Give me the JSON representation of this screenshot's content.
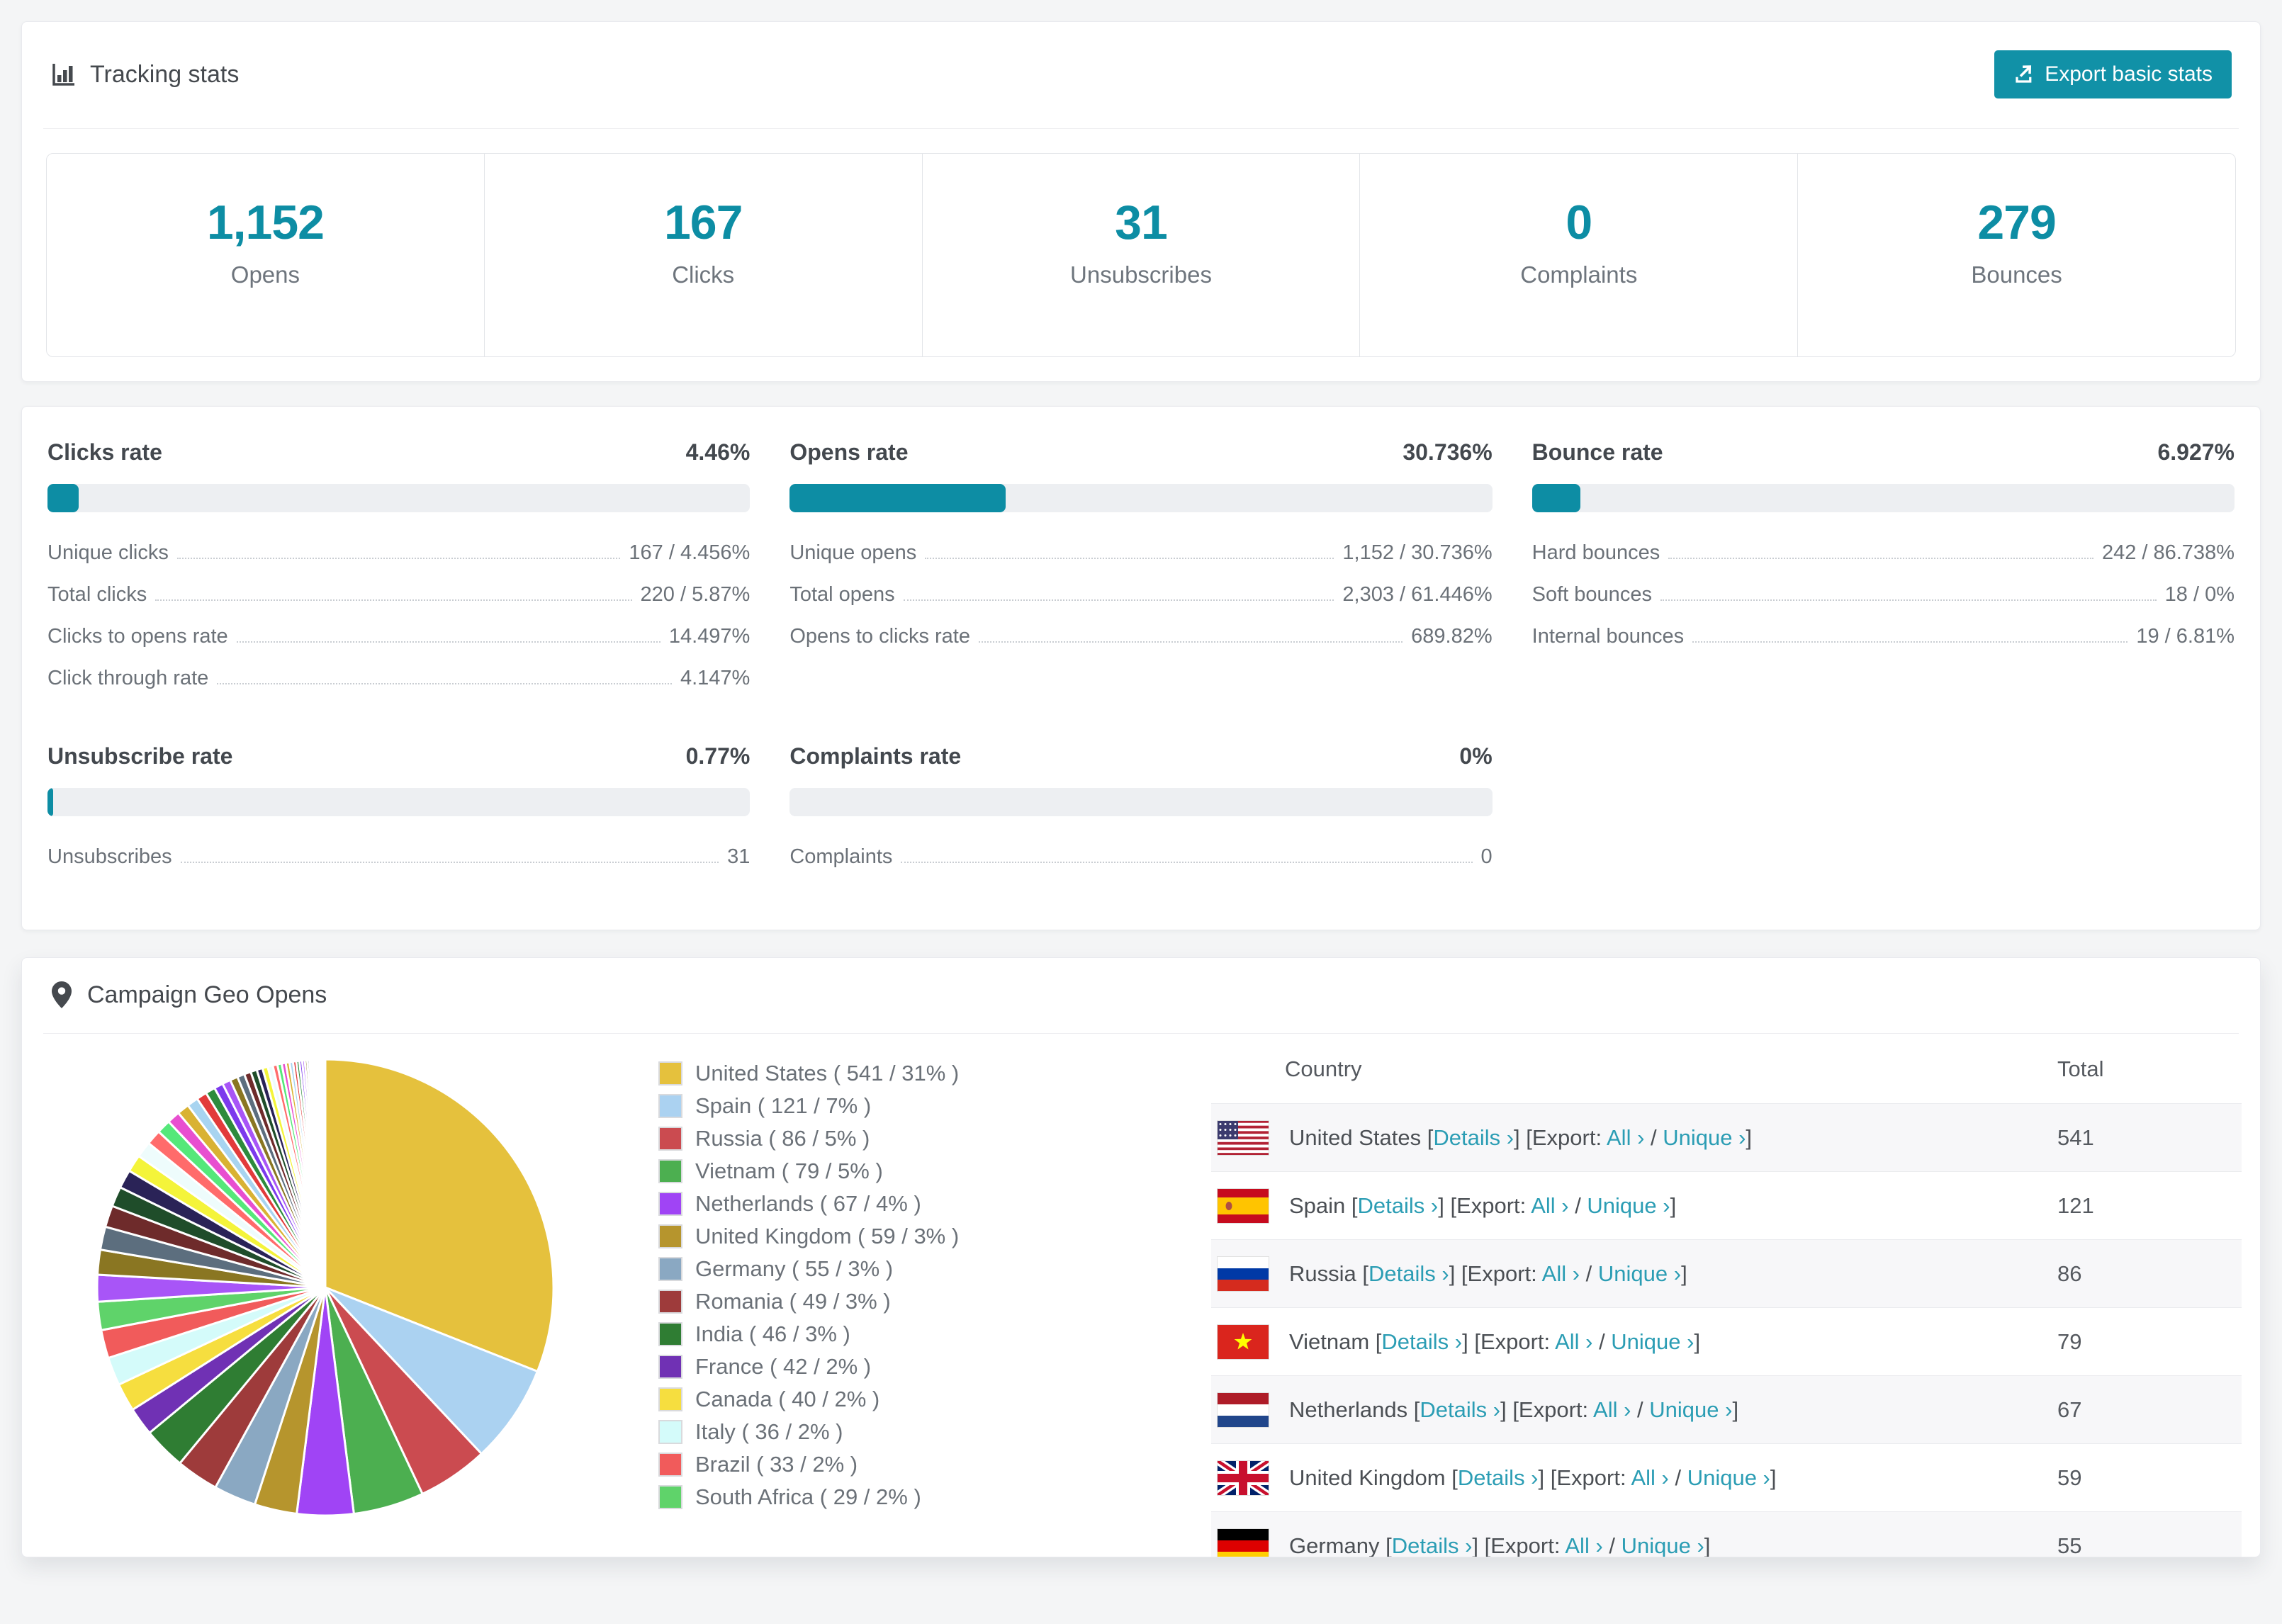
{
  "accent": "#0d8da4",
  "link_color": "#2b9db4",
  "tracking": {
    "title": "Tracking stats",
    "export_button": "Export basic stats",
    "stats": [
      {
        "value": "1,152",
        "label": "Opens"
      },
      {
        "value": "167",
        "label": "Clicks"
      },
      {
        "value": "31",
        "label": "Unsubscribes"
      },
      {
        "value": "0",
        "label": "Complaints"
      },
      {
        "value": "279",
        "label": "Bounces"
      }
    ]
  },
  "rates": [
    {
      "title": "Clicks rate",
      "value": "4.46%",
      "pct": 4.46,
      "rows": [
        {
          "label": "Unique clicks",
          "value": "167 / 4.456%"
        },
        {
          "label": "Total clicks",
          "value": "220 / 5.87%"
        },
        {
          "label": "Clicks to opens rate",
          "value": "14.497%"
        },
        {
          "label": "Click through rate",
          "value": "4.147%"
        }
      ]
    },
    {
      "title": "Opens rate",
      "value": "30.736%",
      "pct": 30.736,
      "rows": [
        {
          "label": "Unique opens",
          "value": "1,152 / 30.736%"
        },
        {
          "label": "Total opens",
          "value": "2,303 / 61.446%"
        },
        {
          "label": "Opens to clicks rate",
          "value": "689.82%"
        }
      ]
    },
    {
      "title": "Bounce rate",
      "value": "6.927%",
      "pct": 6.927,
      "rows": [
        {
          "label": "Hard bounces",
          "value": "242 / 86.738%"
        },
        {
          "label": "Soft bounces",
          "value": "18 / 0%"
        },
        {
          "label": "Internal bounces",
          "value": "19 / 6.81%"
        }
      ]
    },
    {
      "title": "Unsubscribe rate",
      "value": "0.77%",
      "pct": 0.77,
      "rows": [
        {
          "label": "Unsubscribes",
          "value": "31"
        }
      ]
    },
    {
      "title": "Complaints rate",
      "value": "0%",
      "pct": 0,
      "rows": [
        {
          "label": "Complaints",
          "value": "0"
        }
      ]
    }
  ],
  "geo": {
    "title": "Campaign Geo Opens",
    "legend_format": "{label} ( {value} / {pct}% )",
    "table": {
      "col_country": "Country",
      "col_total": "Total",
      "details_label": "Details ›",
      "export_prefix": "Export:",
      "all_label": "All ›",
      "unique_label": "Unique ›",
      "lb": "[",
      "rb": "]",
      "sep": " / ",
      "rows": [
        {
          "country": "United States",
          "flag": "us",
          "total": "541"
        },
        {
          "country": "Spain",
          "flag": "es",
          "total": "121"
        },
        {
          "country": "Russia",
          "flag": "ru",
          "total": "86"
        },
        {
          "country": "Vietnam",
          "flag": "vn",
          "total": "79"
        },
        {
          "country": "Netherlands",
          "flag": "nl",
          "total": "67"
        },
        {
          "country": "United Kingdom",
          "flag": "gb",
          "total": "59"
        },
        {
          "country": "Germany",
          "flag": "de",
          "total": "55"
        }
      ]
    },
    "chart_data": {
      "type": "pie",
      "title": "Campaign Geo Opens",
      "legend_position": "right",
      "start_angle_deg": 0,
      "direction": "clockwise",
      "series": [
        {
          "label": "United States",
          "value": 541,
          "pct": 31,
          "color": "#e5c13d"
        },
        {
          "label": "Spain",
          "value": 121,
          "pct": 7,
          "color": "#abd2f1"
        },
        {
          "label": "Russia",
          "value": 86,
          "pct": 5,
          "color": "#cb4b50"
        },
        {
          "label": "Vietnam",
          "value": 79,
          "pct": 5,
          "color": "#4caf50"
        },
        {
          "label": "Netherlands",
          "value": 67,
          "pct": 4,
          "color": "#a044f5"
        },
        {
          "label": "United Kingdom",
          "value": 59,
          "pct": 3,
          "color": "#b6952d"
        },
        {
          "label": "Germany",
          "value": 55,
          "pct": 3,
          "color": "#8aa8c2"
        },
        {
          "label": "Romania",
          "value": 49,
          "pct": 3,
          "color": "#9e3b3b"
        },
        {
          "label": "India",
          "value": 46,
          "pct": 3,
          "color": "#2f7d33"
        },
        {
          "label": "France",
          "value": 42,
          "pct": 2,
          "color": "#7031b4"
        },
        {
          "label": "Canada",
          "value": 40,
          "pct": 2,
          "color": "#f6de3f"
        },
        {
          "label": "Italy",
          "value": 36,
          "pct": 2,
          "color": "#d4fbfa"
        },
        {
          "label": "Brazil",
          "value": 33,
          "pct": 2,
          "color": "#f15b5b"
        },
        {
          "label": "South Africa",
          "value": 29,
          "pct": 2,
          "color": "#5fd36a"
        }
      ],
      "others": {
        "pct_total": 26,
        "slice_count": 45,
        "decay": 0.93,
        "palette": [
          "#a855f7",
          "#8a7622",
          "#5c6e7e",
          "#6e2b2b",
          "#1f4d2a",
          "#2a2357",
          "#f4f43a",
          "#eefcfc",
          "#ff6b6b",
          "#55e87a",
          "#e84fd0",
          "#d9b233",
          "#a8d4f0",
          "#e23b3b",
          "#2e8b3d",
          "#7c3aed"
        ]
      }
    }
  }
}
